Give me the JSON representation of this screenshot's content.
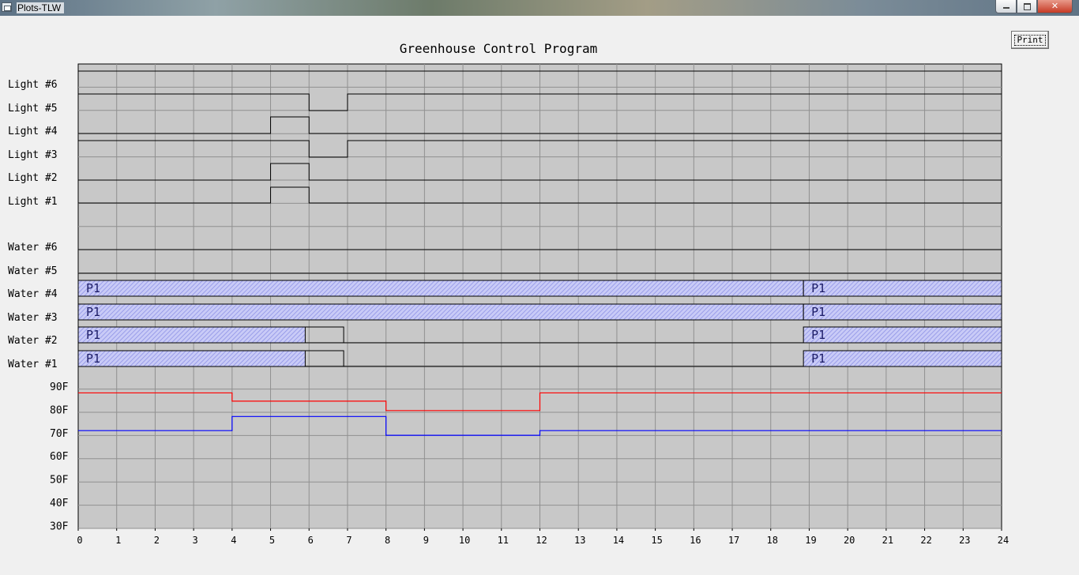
{
  "window": {
    "title": "Plots-TLW"
  },
  "toolbar": {
    "print_label": "Print"
  },
  "plot": {
    "title": "Greenhouse Control Program",
    "x_ticks": [
      "0",
      "1",
      "2",
      "3",
      "4",
      "5",
      "6",
      "7",
      "8",
      "9",
      "10",
      "11",
      "12",
      "13",
      "14",
      "15",
      "16",
      "17",
      "18",
      "19",
      "20",
      "21",
      "22",
      "23",
      "24"
    ],
    "temp_ticks": [
      "90F",
      "80F",
      "70F",
      "60F",
      "50F",
      "40F",
      "30F"
    ],
    "lights": [
      {
        "label": "Light #6",
        "on_periods": []
      },
      {
        "label": "Light #5",
        "on_periods": [
          [
            6,
            7
          ]
        ],
        "polarity": "inverted"
      },
      {
        "label": "Light #4",
        "on_periods": [
          [
            5,
            6
          ]
        ]
      },
      {
        "label": "Light #3",
        "on_periods": [
          [
            6,
            7
          ]
        ],
        "polarity": "inverted"
      },
      {
        "label": "Light #2",
        "on_periods": [
          [
            5,
            6
          ]
        ]
      },
      {
        "label": "Light #1",
        "on_periods": [
          [
            5,
            6
          ]
        ]
      }
    ],
    "water": [
      {
        "label": "Water #6",
        "programs": [],
        "pulses": []
      },
      {
        "label": "Water #5",
        "programs": [],
        "pulses": []
      },
      {
        "label": "Water #4",
        "programs": [
          {
            "start": 0,
            "end": 18.85,
            "label": "P1"
          },
          {
            "start": 18.85,
            "end": 24,
            "label": "P1"
          }
        ],
        "pulses": []
      },
      {
        "label": "Water #3",
        "programs": [
          {
            "start": 0,
            "end": 18.85,
            "label": "P1"
          },
          {
            "start": 18.85,
            "end": 24,
            "label": "P1"
          }
        ],
        "pulses": []
      },
      {
        "label": "Water #2",
        "programs": [
          {
            "start": 0,
            "end": 5.9,
            "label": "P1"
          },
          {
            "start": 18.85,
            "end": 24,
            "label": "P1"
          }
        ],
        "pulses": [
          [
            5.9,
            6.9
          ]
        ]
      },
      {
        "label": "Water #1",
        "programs": [
          {
            "start": 0,
            "end": 5.9,
            "label": "P1"
          },
          {
            "start": 18.85,
            "end": 24,
            "label": "P1"
          }
        ],
        "pulses": [
          [
            5.9,
            6.9
          ]
        ]
      }
    ]
  },
  "chart_data": {
    "type": "line",
    "title": "Greenhouse Control Program",
    "x": [
      0,
      4,
      8,
      12,
      24
    ],
    "xlim": [
      0,
      24
    ],
    "ylim": [
      30,
      90
    ],
    "series": [
      {
        "color": "#ff0000",
        "step": true,
        "values": [
          87.5,
          84,
          80,
          87.5,
          87.5
        ]
      },
      {
        "color": "#0000ff",
        "step": true,
        "values": [
          71.5,
          77.5,
          69.5,
          71.5,
          71.5
        ]
      }
    ]
  }
}
